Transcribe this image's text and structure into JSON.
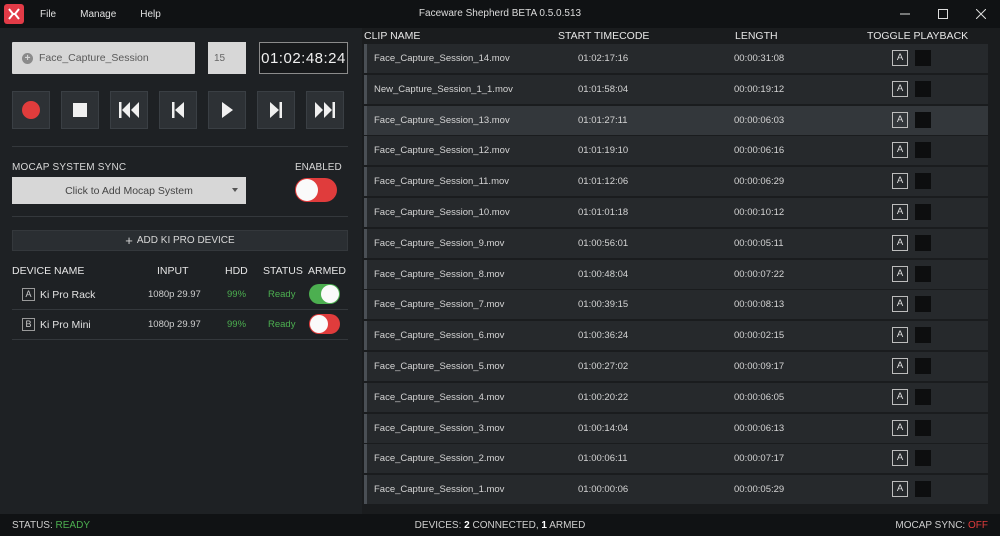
{
  "window": {
    "title": "Faceware Shepherd BETA 0.5.0.513",
    "menu": [
      "File",
      "Manage",
      "Help"
    ]
  },
  "session": {
    "name": "Face_Capture_Session",
    "take": "15",
    "timecode": "01:02:48:24"
  },
  "mocap": {
    "label": "MOCAP SYSTEM SYNC",
    "enabled_label": "ENABLED",
    "dropdown_value": "Click to Add Mocap System",
    "enabled": false
  },
  "devices": {
    "add_label": "ADD KI PRO DEVICE",
    "headers": {
      "name": "DEVICE NAME",
      "input": "INPUT",
      "hdd": "HDD",
      "status": "STATUS",
      "armed": "ARMED"
    },
    "rows": [
      {
        "badge": "A",
        "name": "Ki Pro Rack",
        "input": "1080p 29.97",
        "hdd": "99%",
        "status": "Ready",
        "armed": true
      },
      {
        "badge": "B",
        "name": "Ki Pro Mini",
        "input": "1080p 29.97",
        "hdd": "99%",
        "status": "Ready",
        "armed": false
      }
    ]
  },
  "clips": {
    "headers": {
      "name": "CLIP NAME",
      "start": "START TIMECODE",
      "length": "LENGTH",
      "toggle": "TOGGLE PLAYBACK"
    },
    "rows": [
      {
        "name": "Face_Capture_Session_14.mov",
        "start": "01:02:17:16",
        "length": "00:00:31:08",
        "a": "A"
      },
      {
        "name": "New_Capture_Session_1_1.mov",
        "start": "01:01:58:04",
        "length": "00:00:19:12",
        "a": "A"
      },
      {
        "name": "Face_Capture_Session_13.mov",
        "start": "01:01:27:11",
        "length": "00:00:06:03",
        "a": "A"
      },
      {
        "name": "Face_Capture_Session_12.mov",
        "start": "01:01:19:10",
        "length": "00:00:06:16",
        "a": "A"
      },
      {
        "name": "Face_Capture_Session_11.mov",
        "start": "01:01:12:06",
        "length": "00:00:06:29",
        "a": "A"
      },
      {
        "name": "Face_Capture_Session_10.mov",
        "start": "01:01:01:18",
        "length": "00:00:10:12",
        "a": "A"
      },
      {
        "name": "Face_Capture_Session_9.mov",
        "start": "01:00:56:01",
        "length": "00:00:05:11",
        "a": "A"
      },
      {
        "name": "Face_Capture_Session_8.mov",
        "start": "01:00:48:04",
        "length": "00:00:07:22",
        "a": "A"
      },
      {
        "name": "Face_Capture_Session_7.mov",
        "start": "01:00:39:15",
        "length": "00:00:08:13",
        "a": "A"
      },
      {
        "name": "Face_Capture_Session_6.mov",
        "start": "01:00:36:24",
        "length": "00:00:02:15",
        "a": "A"
      },
      {
        "name": "Face_Capture_Session_5.mov",
        "start": "01:00:27:02",
        "length": "00:00:09:17",
        "a": "A"
      },
      {
        "name": "Face_Capture_Session_4.mov",
        "start": "01:00:20:22",
        "length": "00:00:06:05",
        "a": "A"
      },
      {
        "name": "Face_Capture_Session_3.mov",
        "start": "01:00:14:04",
        "length": "00:00:06:13",
        "a": "A"
      },
      {
        "name": "Face_Capture_Session_2.mov",
        "start": "01:00:06:11",
        "length": "00:00:07:17",
        "a": "A"
      },
      {
        "name": "Face_Capture_Session_1.mov",
        "start": "01:00:00:06",
        "length": "00:00:05:29",
        "a": "A"
      }
    ],
    "selected_index": 2
  },
  "status": {
    "status_label": "STATUS:",
    "status_value": "READY",
    "devices_label": "DEVICES:",
    "connected_count": "2",
    "connected_label": "CONNECTED,",
    "armed_count": "1",
    "armed_label": "ARMED",
    "mocap_label": "MOCAP SYNC:",
    "mocap_value": "OFF"
  },
  "colors": {
    "accent_red": "#e03c3c",
    "accent_green": "#4caf50",
    "logo": "#e23b47"
  }
}
